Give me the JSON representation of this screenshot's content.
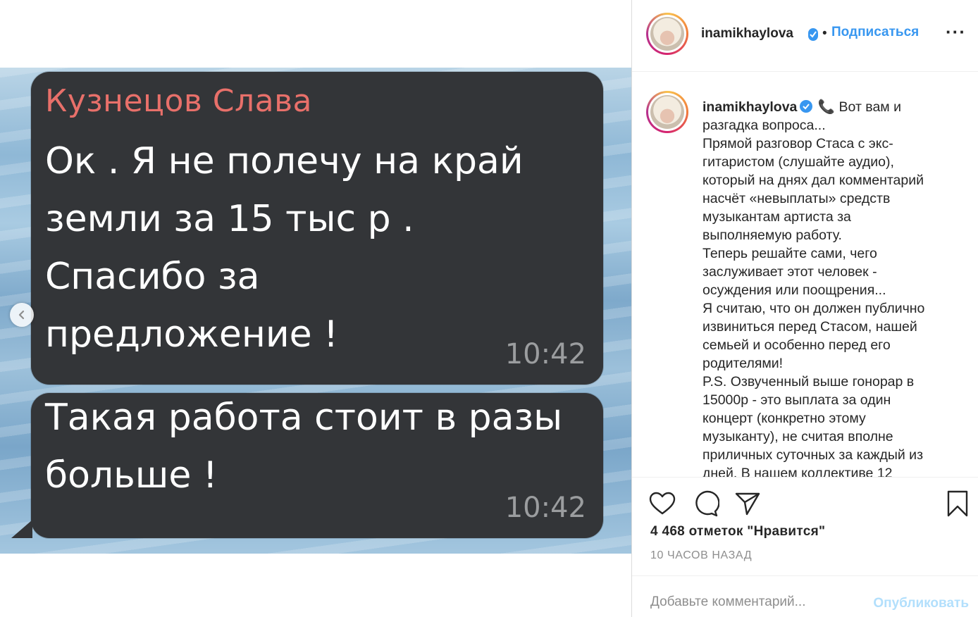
{
  "post": {
    "messages": [
      {
        "sender": "Кузнецов Слава",
        "text": "Ок . Я не полечу на край\nземли за 15 тыс р .\nСпасибо за\nпредложение !",
        "time": "10:42"
      },
      {
        "sender": "",
        "text": "Такая работа стоит в разы\nбольше !",
        "time": "10:42"
      }
    ]
  },
  "header": {
    "username": "inamikhaylova",
    "separator": "•",
    "follow_label": "Подписаться",
    "more_label": "···"
  },
  "caption": {
    "username": "inamikhaylova",
    "emoji": "📞",
    "text": "Вот вам и\nразгадка вопроса...\nПрямой разговор Стаса с экс-\nгитаристом (слушайте аудио),\nкоторый на днях дал комментарий\nнасчёт «невыплаты» средств\nмузыкантам артиста за\nвыполняемую работу.\nТеперь решайте сами, чего\nзаслуживает этот человек -\nосуждения или поощрения...\nЯ считаю, что он должен публично\nизвиниться перед Стасом, нашей\nсемьей и особенно перед его\nродителями!\nP.S. Озвученный выше гонорар в\n15000р - это выплата за один\nконцерт (конкретно этому\nмузыканту), не считая вполне\nприличных суточных за каждый из\nдней. В нашем коллективе 12"
  },
  "stats": {
    "likes": "4 468 отметок \"Нравится\"",
    "time_ago": "10 ЧАСОВ НАЗАД"
  },
  "comment": {
    "placeholder": "Добавьте комментарий...",
    "publish_label": "Опубликовать"
  },
  "icons": [
    "heart-icon",
    "comment-icon",
    "share-icon",
    "bookmark-icon",
    "chevron-left-icon",
    "verified-icon"
  ],
  "colors": {
    "accent": "#3897f0",
    "publish_disabled": "#b2dffc",
    "sender_name": "#e8706a",
    "bubble": "#333538"
  }
}
